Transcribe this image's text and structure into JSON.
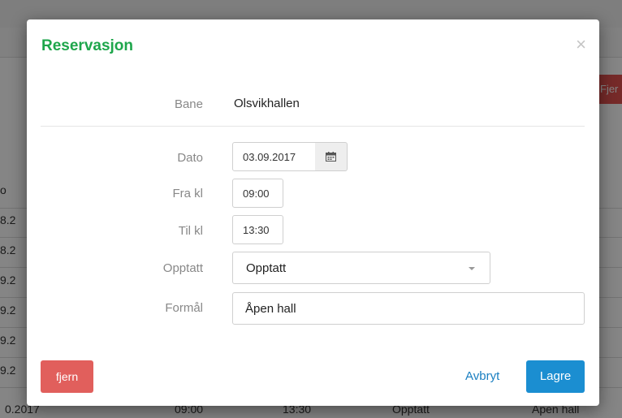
{
  "background": {
    "button_label": "Fjer",
    "rows": [
      {
        "date": "0.2017",
        "from": "09:00",
        "to": "13:30",
        "status": "Opptatt",
        "purpose": "Åpen hall"
      }
    ],
    "left_fragments": [
      "o",
      "8.2",
      "8.2",
      "9.2",
      "9.2",
      "9.2",
      "9.2"
    ]
  },
  "modal": {
    "title": "Reservasjon",
    "close_symbol": "×",
    "fields": {
      "bane_label": "Bane",
      "bane_value": "Olsvikhallen",
      "dato_label": "Dato",
      "dato_value": "03.09.2017",
      "fra_label": "Fra kl",
      "fra_value": "09:00",
      "til_label": "Til kl",
      "til_value": "13:30",
      "opptatt_label": "Opptatt",
      "opptatt_value": "Opptatt",
      "formal_label": "Formål",
      "formal_value": "Åpen hall"
    },
    "buttons": {
      "delete": "fjern",
      "cancel": "Avbryt",
      "save": "Lagre"
    }
  },
  "icons": {
    "calendar": "calendar-icon",
    "caret": "chevron-down-icon",
    "close": "close-icon"
  },
  "colors": {
    "title": "#1ea64b",
    "danger": "#e15f5c",
    "primary": "#1b8ed1",
    "link": "#1a7fc1"
  }
}
